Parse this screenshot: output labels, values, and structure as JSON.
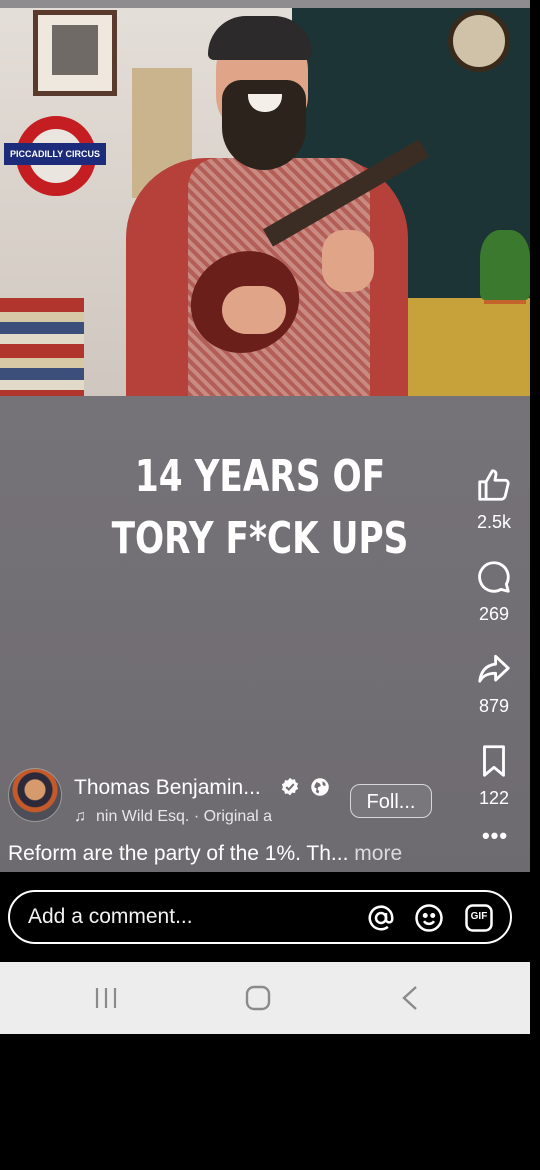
{
  "video": {
    "sign_text": "PICCADILLY CIRCUS",
    "caption_line1": "14 YEARS OF",
    "caption_line2": "TORY F*CK UPS"
  },
  "actions": {
    "like_count": "2.5k",
    "comment_count": "269",
    "share_count": "879",
    "save_count": "122",
    "more_label": "•••"
  },
  "author": {
    "name": "Thomas Benjamin...",
    "audio": "nin Wild Esq. · Original a",
    "follow_label": "Foll..."
  },
  "description": {
    "text": "Reform are the party of the 1%. Th...",
    "more": " more"
  },
  "comment": {
    "placeholder": "Add a comment...",
    "mention_icon": "at-sign-icon",
    "emoji_icon": "smiley-icon",
    "gif_icon": "gif-icon",
    "gif_label": "GIF"
  },
  "navbar": {
    "recents": "recent-apps-icon",
    "home": "home-icon",
    "back": "back-icon"
  },
  "colors": {
    "reel_bg": "#767379",
    "nav_bg": "#ededed",
    "text": "#ffffff"
  }
}
